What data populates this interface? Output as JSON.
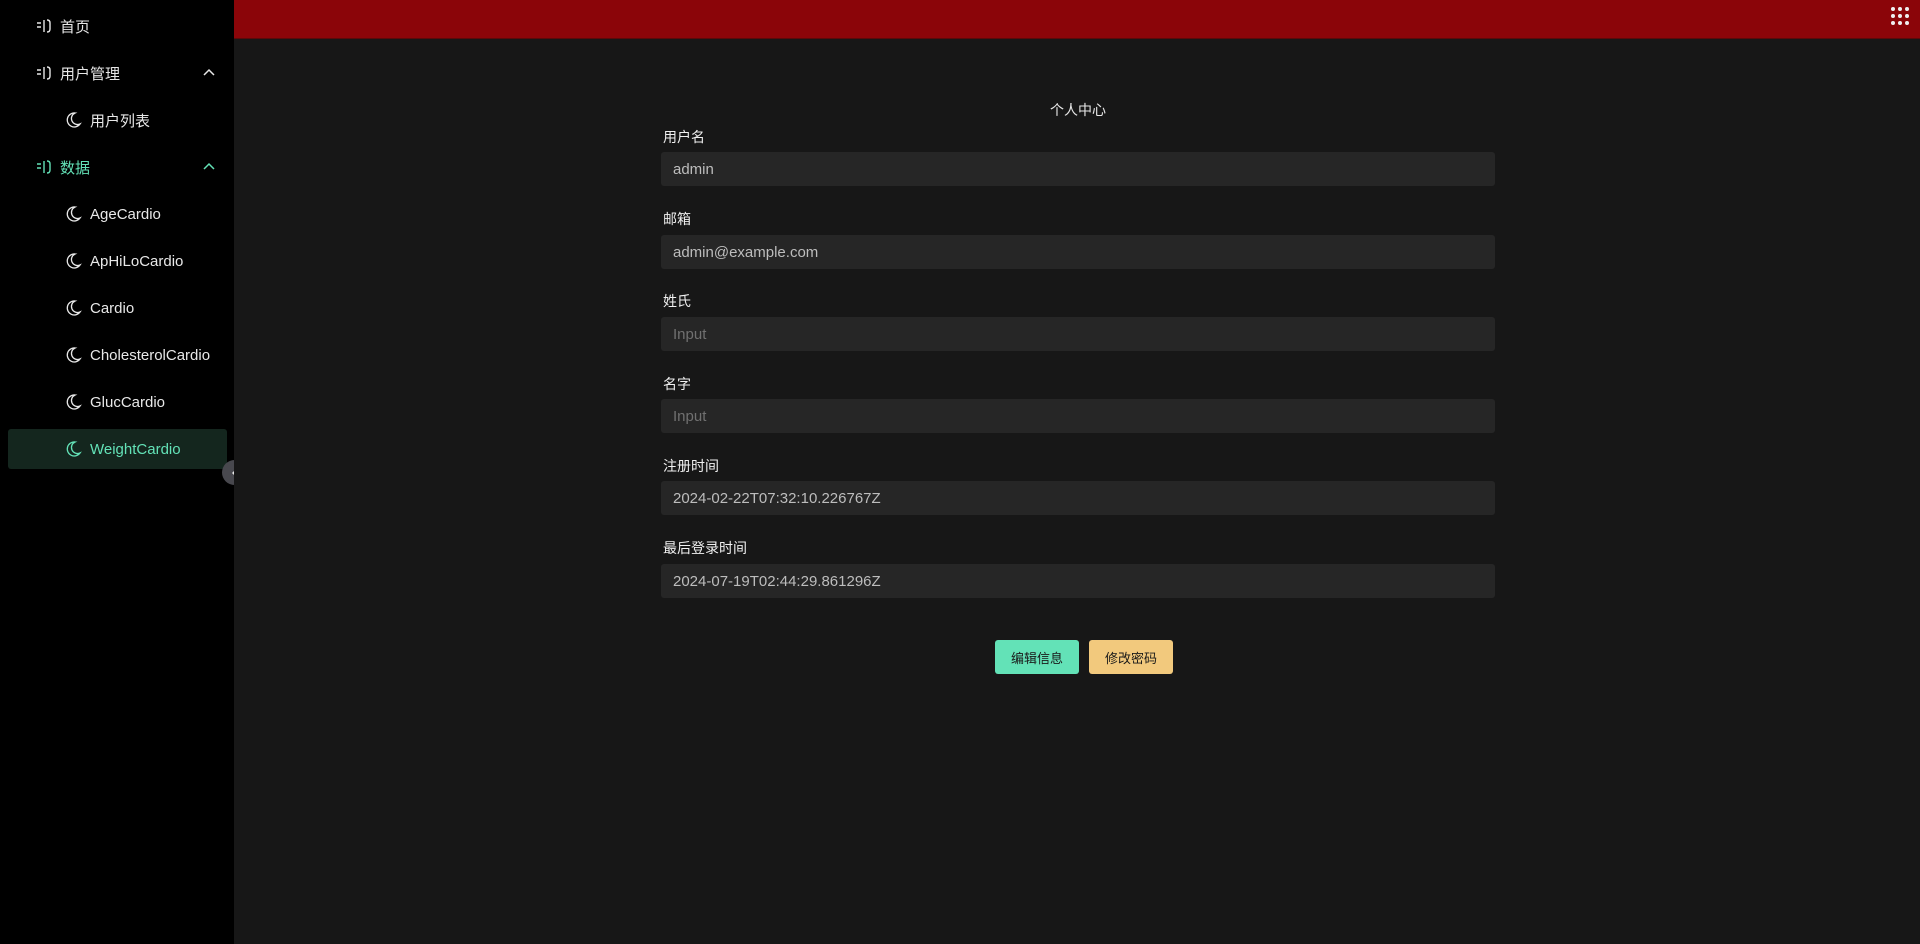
{
  "sidebar": {
    "items": [
      {
        "label": "首页",
        "icon": "home-icon"
      },
      {
        "label": "用户管理",
        "icon": "user-group-icon",
        "expanded": true
      },
      {
        "label": "用户列表",
        "icon": "moon-icon"
      },
      {
        "label": "数据",
        "icon": "data-icon",
        "expanded": true
      },
      {
        "label": "AgeCardio",
        "icon": "moon-icon"
      },
      {
        "label": "ApHiLoCardio",
        "icon": "moon-icon"
      },
      {
        "label": "Cardio",
        "icon": "moon-icon"
      },
      {
        "label": "CholesterolCardio",
        "icon": "moon-icon"
      },
      {
        "label": "GlucCardio",
        "icon": "moon-icon"
      },
      {
        "label": "WeightCardio",
        "icon": "moon-icon",
        "active": true
      }
    ]
  },
  "colors": {
    "topbar": "#8b0509",
    "accent_green": "#63e2b7",
    "accent_yellow": "#f2c97d",
    "sidebar_bg": "#000000",
    "main_bg": "#171717"
  },
  "profile": {
    "title": "个人中心",
    "fields": [
      {
        "label": "用户名",
        "value": "admin",
        "placeholder": ""
      },
      {
        "label": "邮箱",
        "value": "admin@example.com",
        "placeholder": ""
      },
      {
        "label": "姓氏",
        "value": "",
        "placeholder": "Input"
      },
      {
        "label": "名字",
        "value": "",
        "placeholder": "Input"
      },
      {
        "label": "注册时间",
        "value": "2024-02-22T07:32:10.226767Z",
        "placeholder": ""
      },
      {
        "label": "最后登录时间",
        "value": "2024-07-19T02:44:29.861296Z",
        "placeholder": ""
      }
    ],
    "edit_label": "编辑信息",
    "change_password_label": "修改密码"
  }
}
